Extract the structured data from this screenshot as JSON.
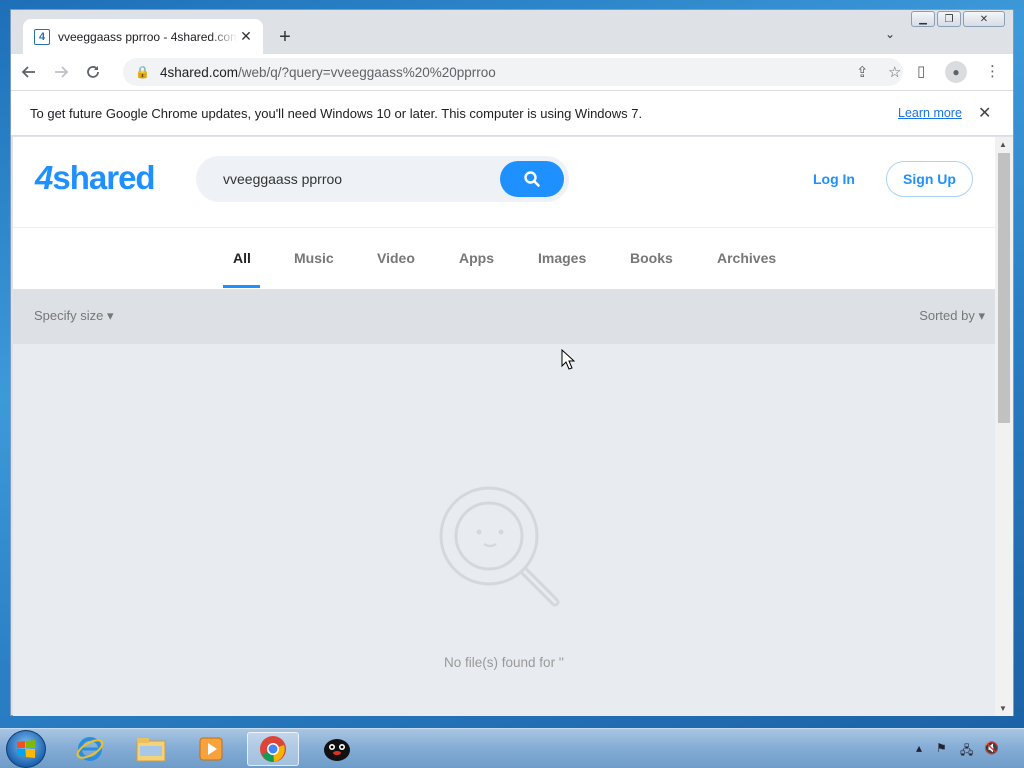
{
  "browser": {
    "tab_title": "vveeggaass pprroo - 4shared.com",
    "tab_favicon": "4",
    "new_tab_symbol": "+",
    "tab_close_symbol": "✕",
    "url_host": "4shared.com",
    "url_path": "/web/q/?query=vveeggaass%20%20pprroo",
    "infobar_message": "To get future Google Chrome updates, you'll need Windows 10 or later. This computer is using Windows 7.",
    "infobar_link": "Learn more"
  },
  "site": {
    "logo_number": "4",
    "logo_text": "shared",
    "search_value": "vveeggaass  pprroo",
    "login_label": "Log In",
    "signup_label": "Sign Up",
    "accent_color": "#1e90ff",
    "tabs": [
      {
        "label": "All",
        "active": true
      },
      {
        "label": "Music"
      },
      {
        "label": "Video"
      },
      {
        "label": "Apps"
      },
      {
        "label": "Images"
      },
      {
        "label": "Books"
      },
      {
        "label": "Archives"
      }
    ],
    "filter_size": "Specify size",
    "filter_sort": "Sorted by",
    "empty_message": "No file(s) found for ''"
  },
  "taskbar": {
    "apps": [
      "internet-explorer-icon",
      "file-explorer-icon",
      "media-player-icon",
      "chrome-icon",
      "penguin-app-icon"
    ]
  }
}
